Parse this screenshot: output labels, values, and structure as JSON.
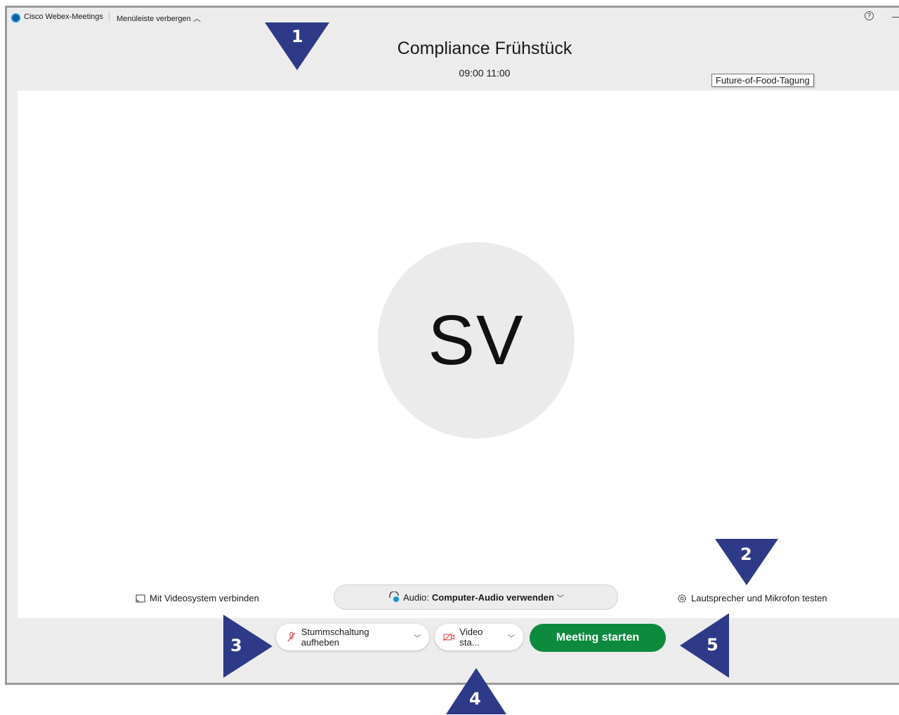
{
  "menubar": {
    "app_name": "Cisco Webex-Meetings",
    "hide_menu": "Menüleiste verbergen"
  },
  "meeting": {
    "title": "Compliance Frühstück",
    "time": "09:00 11:00",
    "tooltip": "Future-of-Food-Tagung",
    "initials": "SV"
  },
  "controls": {
    "connect_video": "Mit Videosystem verbinden",
    "audio_prefix": "Audio:",
    "audio_value": "Computer-Audio verwenden",
    "test_audio": "Lautsprecher und Mikrofon testen",
    "unmute": "Stummschaltung aufheben",
    "video": "Video sta...",
    "start": "Meeting starten"
  },
  "markers": [
    "1",
    "2",
    "3",
    "4",
    "5"
  ],
  "colors": {
    "marker": "#2e3a87",
    "start_button": "#0d8a3e",
    "muted_red": "#e0302e"
  }
}
